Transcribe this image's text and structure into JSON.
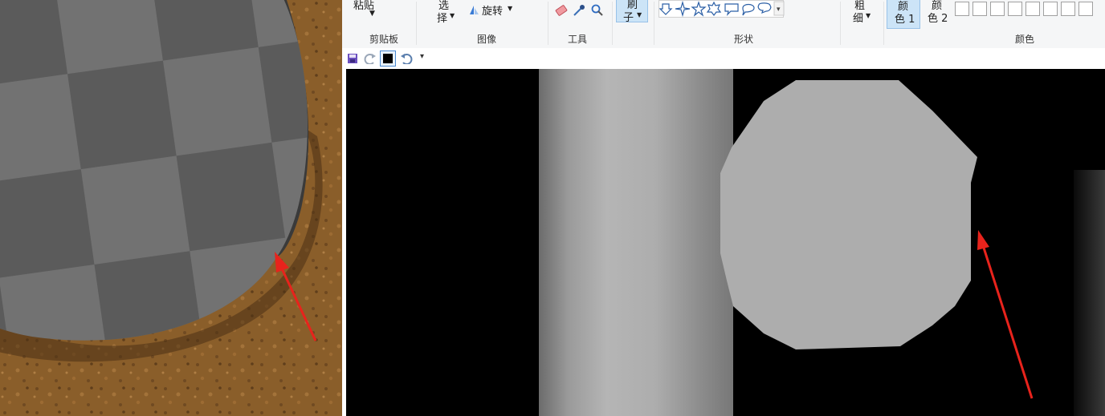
{
  "paint": {
    "clipboard": {
      "paste_label": "粘贴",
      "group_label": "剪贴板"
    },
    "image": {
      "select_label_1": "选",
      "select_label_2": "择",
      "rotate_label": "旋转",
      "group_label": "图像"
    },
    "tools": {
      "group_label": "工具"
    },
    "brush": {
      "label_1": "刷",
      "label_2": "子"
    },
    "shapes": {
      "group_label": "形状"
    },
    "size": {
      "label_1": "粗",
      "label_2": "细"
    },
    "colors": {
      "color1_label_1": "颜",
      "color1_label_2": "色 1",
      "color2_label_1": "颜",
      "color2_label_2": "色 2",
      "group_label": "颜色"
    },
    "canvas_colors": {
      "background": "#000000",
      "circle": "#adadad",
      "arrow": "#e8231c"
    }
  }
}
